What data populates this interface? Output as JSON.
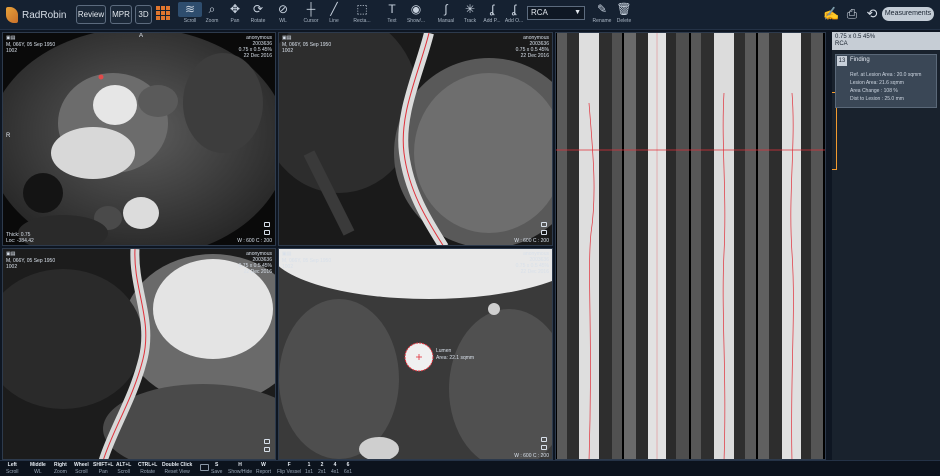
{
  "app": {
    "name": "RadRobin"
  },
  "toolbar": {
    "review_label": "Review",
    "mpr_label": "MPR",
    "threed_label": "3D",
    "tools": [
      {
        "label": "Scroll",
        "icon": "layers-icon"
      },
      {
        "label": "Zoom",
        "icon": "zoom-icon"
      },
      {
        "label": "Pan",
        "icon": "pan-icon"
      },
      {
        "label": "Rotate",
        "icon": "rotate-icon"
      },
      {
        "label": "WL",
        "icon": "window-level-icon"
      },
      {
        "label": "Cursor",
        "icon": "crosshair-icon"
      },
      {
        "label": "Line",
        "icon": "line-icon"
      },
      {
        "label": "Recta...",
        "icon": "rectangle-icon"
      },
      {
        "label": "Text",
        "icon": "text-icon"
      },
      {
        "label": "Show/...",
        "icon": "eye-icon"
      },
      {
        "label": "Manual",
        "icon": "manual-icon"
      },
      {
        "label": "Track",
        "icon": "track-icon"
      },
      {
        "label": "Add P...",
        "icon": "add-point-icon"
      },
      {
        "label": "Add O...",
        "icon": "add-object-icon"
      }
    ],
    "vessel_select": "RCA",
    "rename_label": "Rename",
    "delete_label": "Delete",
    "measurements_label": "Measurements"
  },
  "viewports": {
    "axial": {
      "pid": "2003636",
      "name": "anonymous",
      "series": "0.75 x 0.5 45%",
      "date": "22 Dec 2016",
      "patient": "M, 066Y, 05 Sep 1950",
      "id": "1002",
      "orient_top": "A",
      "orient_left": "R",
      "thick": "Thick: 0.75",
      "loc": "Loc: -384.42",
      "wl": "W : 600 C : 200"
    },
    "curved": {
      "pid": "2003636",
      "name": "anonymous",
      "series": "0.75 x 0.5 45%",
      "date": "22 Dec 2016",
      "patient": "M, 066Y, 05 Sep 1950",
      "id": "1002",
      "wl": "W : 600 C : 200"
    },
    "longitudinal": {
      "pid": "2003636",
      "name": "anonymous",
      "series": "0.75 x 0.5 45%",
      "date": "22 Dec 2016",
      "patient": "M, 066Y, 05 Sep 1950",
      "id": "1002"
    },
    "cross": {
      "pid": "2003636",
      "name": "anonymous",
      "series": "0.75 x 0.5 45%",
      "date": "22 Dec 2016",
      "patient": "M, 066Y, 05 Sep 1950",
      "id": "1002",
      "lumen_label": "Lumen",
      "area_label": "Area: 22.1 sqmm",
      "wl": "W : 600 C : 200"
    }
  },
  "panel": {
    "header_line1": "0.75 x 0.5 45%",
    "header_line2": "RCA",
    "item": {
      "number": "13",
      "title": "Finding",
      "lines": [
        "Ref. at Lesion Area : 20.0 sqmm",
        "Lesion Area: 21.6 sqmm",
        "Area Change : 108 %",
        "Dist to Lesion : 25.0 mm"
      ]
    }
  },
  "statusbar": [
    {
      "key": "Left",
      "action": "Scroll"
    },
    {
      "key": "Middle",
      "action": "WL"
    },
    {
      "key": "Right",
      "action": "Zoom"
    },
    {
      "key": "Wheel",
      "action": "Scroll"
    },
    {
      "key": "SHIFT+L",
      "action": "Pan"
    },
    {
      "key": "ALT+L",
      "action": "Scroll"
    },
    {
      "key": "CTRL+L",
      "action": "Rotate"
    },
    {
      "key": "Double Click",
      "action": "Reset View"
    },
    {
      "key": "S",
      "action": "Save"
    },
    {
      "key": "H",
      "action": "Show/Hide"
    },
    {
      "key": "W",
      "action": "Report"
    },
    {
      "key": "F",
      "action": "Flip Vessel"
    },
    {
      "key": "1",
      "action": "1x1"
    },
    {
      "key": "2",
      "action": "2x1"
    },
    {
      "key": "4",
      "action": "4x1"
    },
    {
      "key": "6",
      "action": "6x1"
    }
  ],
  "colors": {
    "accent": "#e0762e",
    "centerline": "#e0303a",
    "highlight": "#f29a2e"
  }
}
